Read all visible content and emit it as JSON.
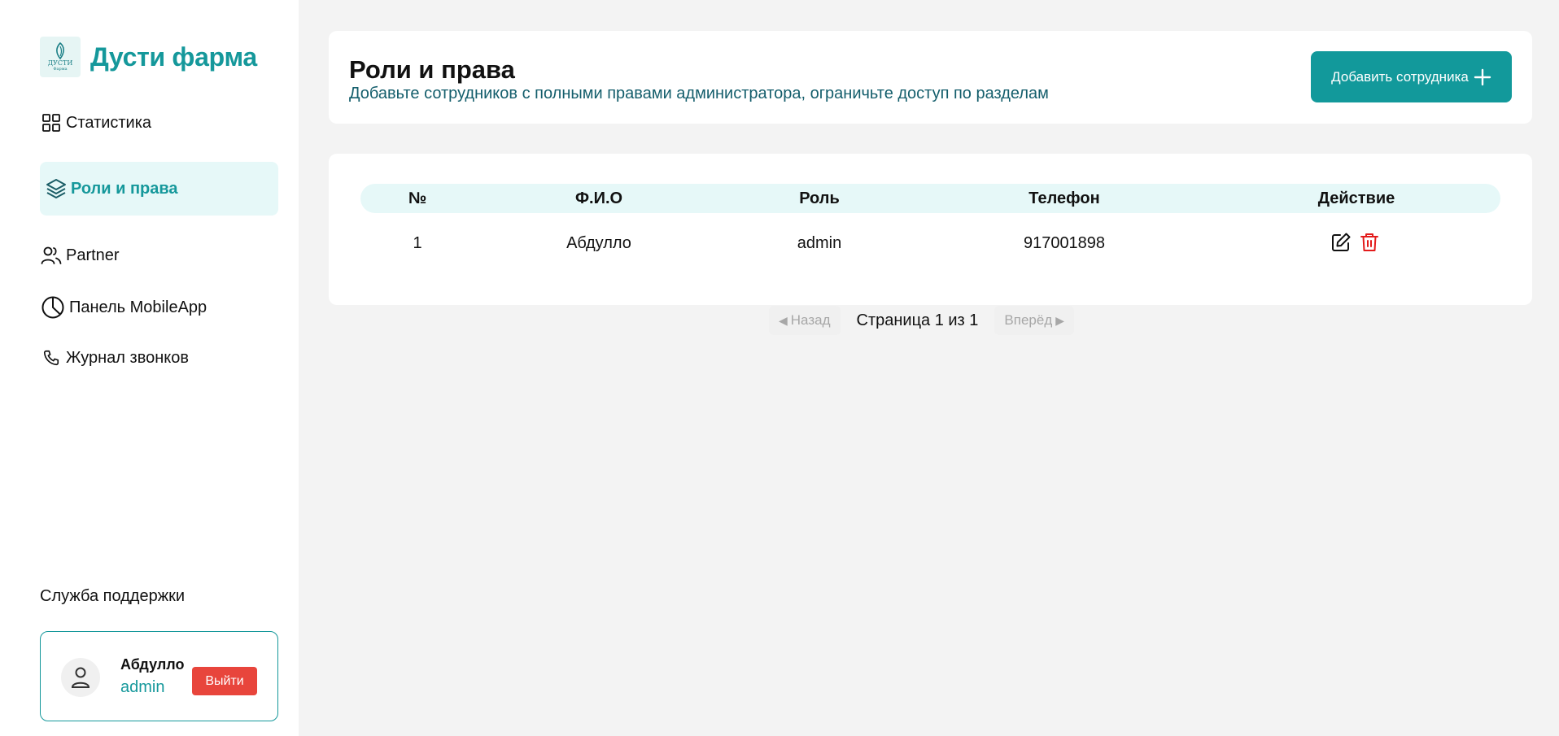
{
  "brand": {
    "name": "Дусти фарма",
    "logo_text": "ДУСТИ",
    "logo_sub": "Фарма"
  },
  "sidebar": {
    "items": [
      {
        "label": "Статистика",
        "icon": "grid-icon"
      },
      {
        "label": "Роли и права",
        "icon": "layers-icon",
        "active": true
      },
      {
        "label": "Partner",
        "icon": "users-icon"
      },
      {
        "label": "Панель MobileApp",
        "icon": "pie-chart-icon"
      },
      {
        "label": "Журнал звонков",
        "icon": "phone-icon"
      }
    ],
    "support_label": "Служба поддержки",
    "user": {
      "name": "Абдулло",
      "role": "admin",
      "logout_label": "Выйти"
    }
  },
  "header": {
    "title": "Роли и права",
    "subtitle": "Добавьте сотрудников с полными правами администратора, ограничьте доступ по разделам",
    "add_button_label": "Добавить сотрудника"
  },
  "table": {
    "columns": [
      "№",
      "Ф.И.О",
      "Роль",
      "Телефон",
      "Действие"
    ],
    "rows": [
      {
        "num": "1",
        "name": "Абдулло",
        "role": "admin",
        "phone": "917001898"
      }
    ]
  },
  "pagination": {
    "prev_label": "Назад",
    "page_label": "Страница 1 из 1",
    "next_label": "Вперёд"
  },
  "colors": {
    "accent": "#15989b",
    "active_bg": "#e6f8f8",
    "danger": "#e8453c",
    "subtitle": "#145e6c",
    "background": "#f3f3f3"
  }
}
